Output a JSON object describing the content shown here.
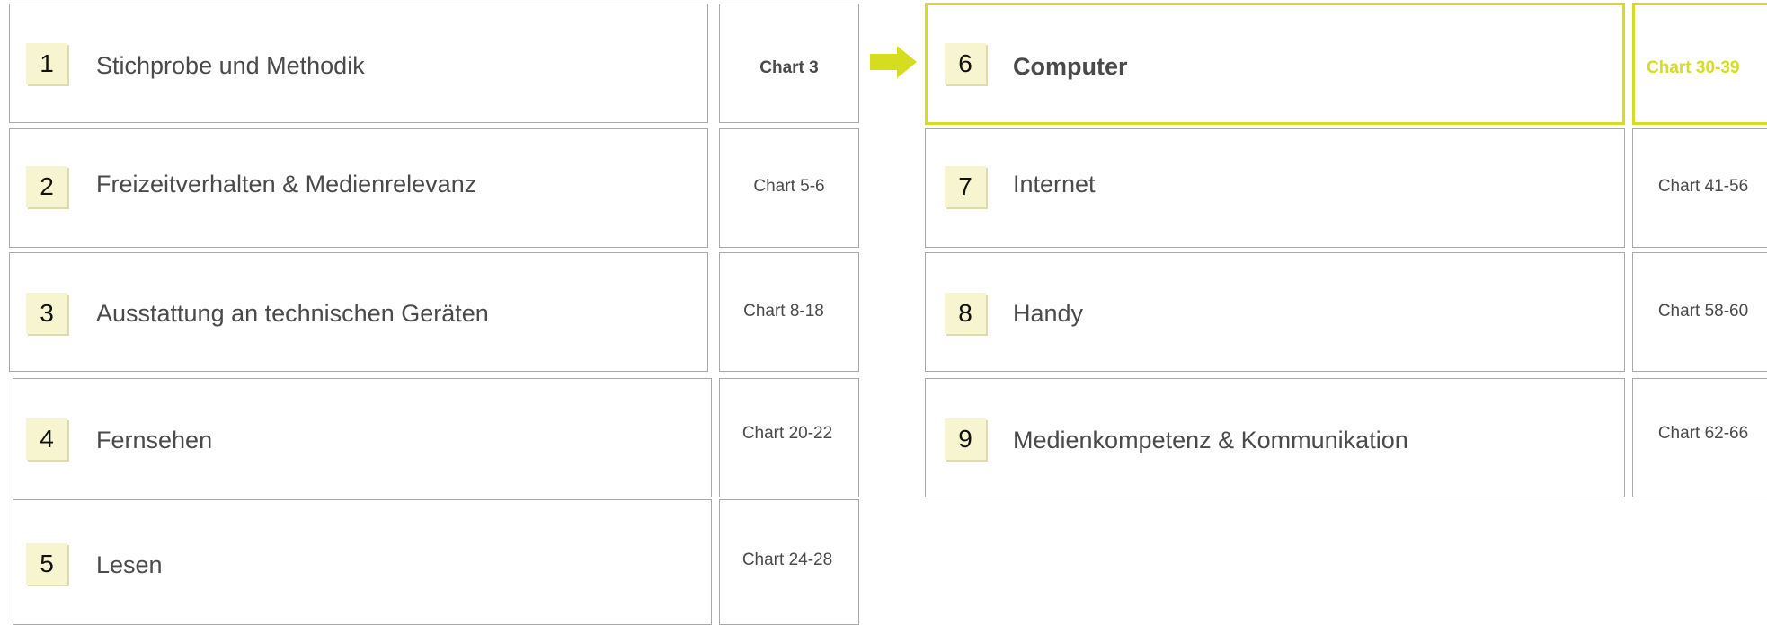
{
  "colors": {
    "accent": "#d6dc1f",
    "border": "#a9a9a9",
    "number_badge": "#f6f5cf",
    "text": "#4a4a4a"
  },
  "sections": [
    {
      "number": "1",
      "title": "Stichprobe und Methodik",
      "charts": "Chart 3"
    },
    {
      "number": "2",
      "title": "Freizeitverhalten & Medienrelevanz",
      "charts": "Chart 5-6"
    },
    {
      "number": "3",
      "title": "Ausstattung an technischen Geräten",
      "charts": "Chart 8-18"
    },
    {
      "number": "4",
      "title": "Fernsehen",
      "charts": "Chart 20-22"
    },
    {
      "number": "5",
      "title": "Lesen",
      "charts": "Chart 24-28"
    },
    {
      "number": "6",
      "title": "Computer",
      "charts": "Chart 30-39",
      "current": true
    },
    {
      "number": "7",
      "title": "Internet",
      "charts": "Chart 41-56"
    },
    {
      "number": "8",
      "title": "Handy",
      "charts": "Chart 58-60"
    },
    {
      "number": "9",
      "title": "Medienkompetenz & Kommunikation",
      "charts": "Chart 62-66"
    }
  ],
  "indicator": {
    "icon": "arrow-right-icon"
  }
}
